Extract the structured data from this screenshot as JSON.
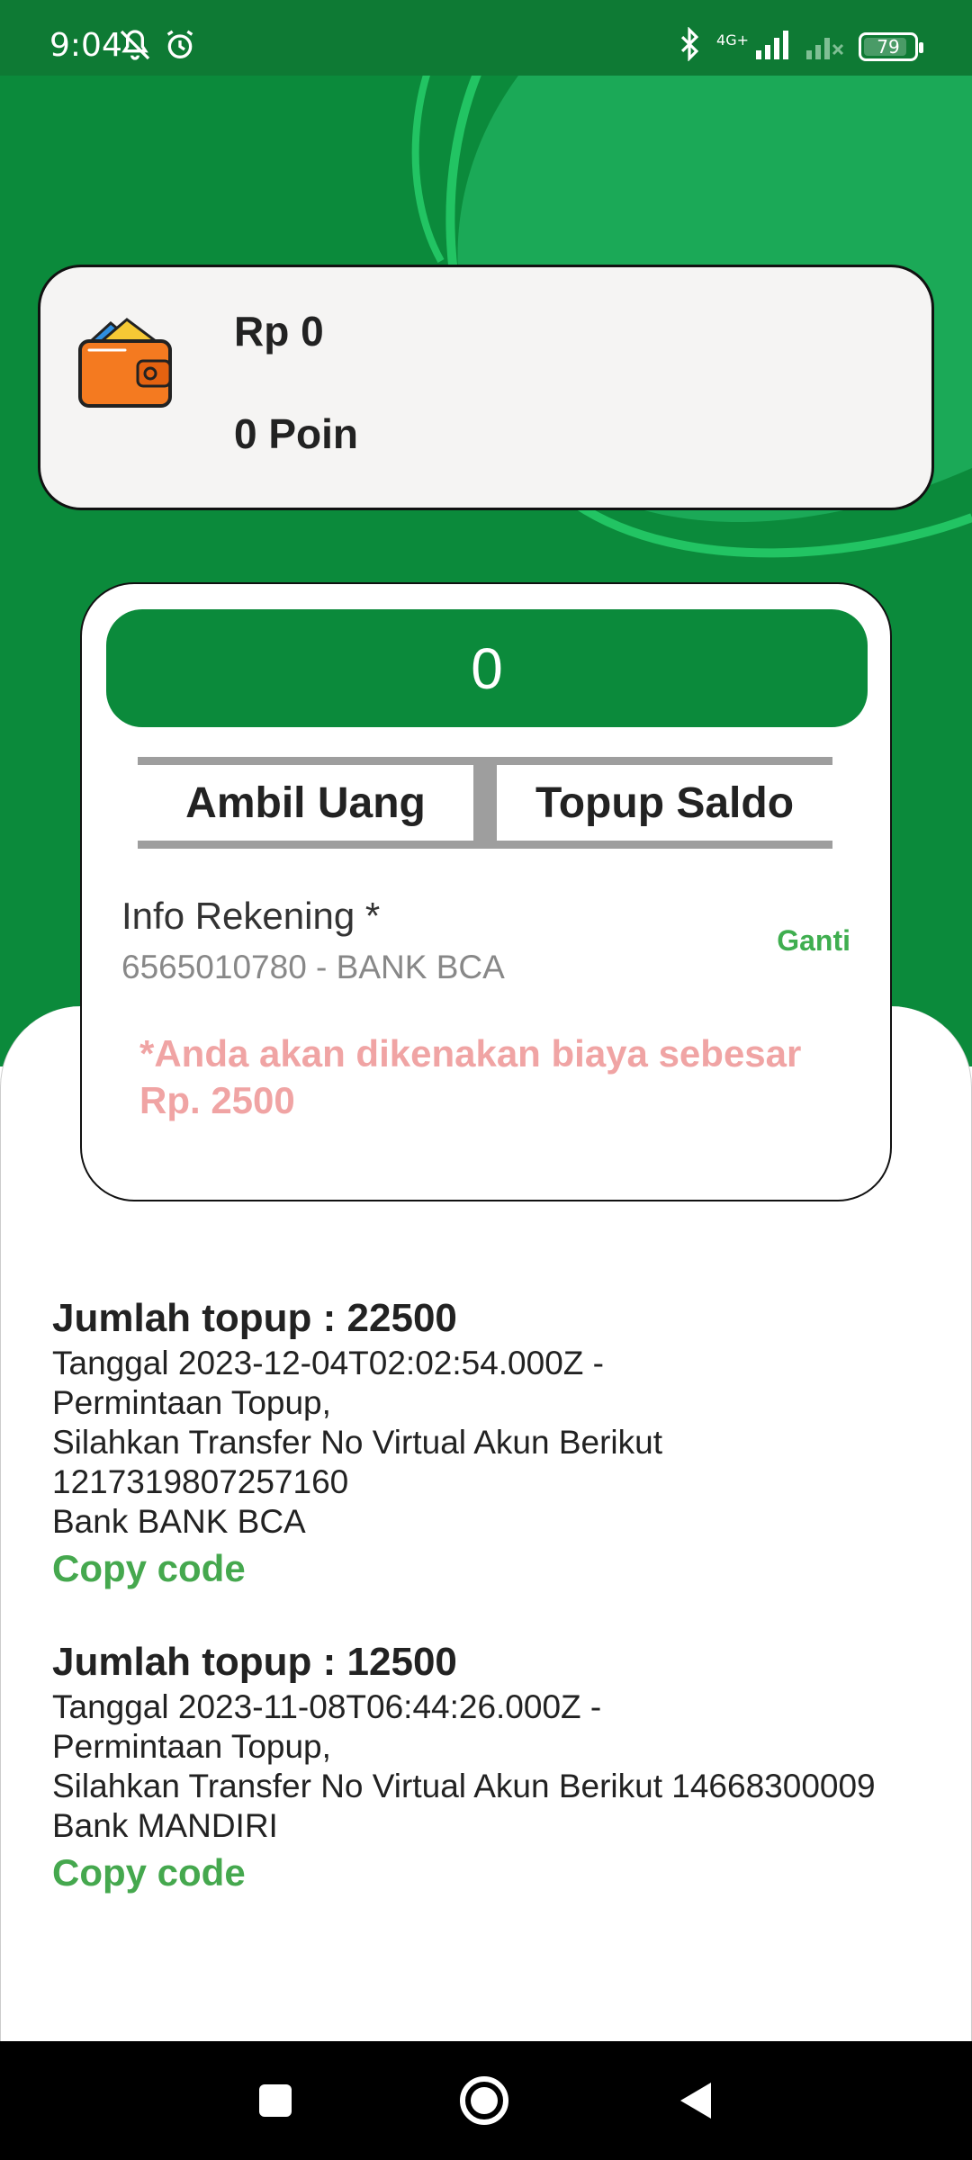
{
  "status_bar": {
    "time": "9:04",
    "network": "4G+",
    "battery": "79",
    "icons": [
      "bell-off-icon",
      "alarm-icon",
      "bluetooth-icon",
      "signal-icon",
      "no-signal-icon",
      "battery-icon"
    ]
  },
  "balance": {
    "amount": "Rp 0",
    "points": "0 Poin",
    "icon": "wallet-icon"
  },
  "form": {
    "amount_value": "0",
    "tabs": [
      "Ambil Uang",
      "Topup Saldo"
    ],
    "account_label": "Info Rekening *",
    "account_value": "6565010780 - BANK BCA",
    "change_label": "Ganti",
    "fee_notice": "*Anda akan dikenakan biaya sebesar Rp. 2500"
  },
  "history": [
    {
      "title": "Jumlah topup : 22500",
      "lines": [
        "Tanggal 2023-12-04T02:02:54.000Z -",
        "Permintaan Topup,",
        "Silahkan Transfer No Virtual Akun Berikut",
        "1217319807257160",
        "Bank BANK BCA"
      ],
      "copy_label": "Copy code"
    },
    {
      "title": "Jumlah topup : 12500",
      "lines": [
        "Tanggal 2023-11-08T06:44:26.000Z -",
        "Permintaan Topup,",
        "Silahkan Transfer No Virtual Akun Berikut 14668300009",
        "Bank MANDIRI"
      ],
      "copy_label": "Copy code"
    }
  ],
  "colors": {
    "primary_green": "#0b8a3b",
    "accent_green": "#45a84e",
    "fee_pink": "#f0a4a4"
  }
}
